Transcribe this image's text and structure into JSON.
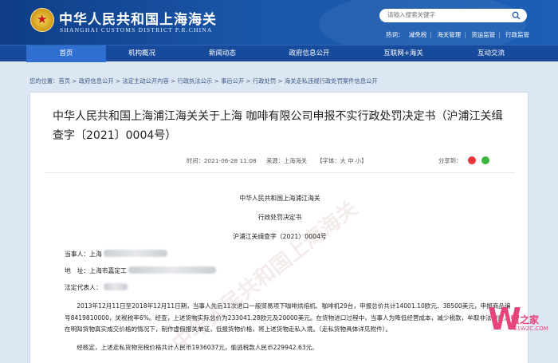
{
  "header": {
    "title": "中华人民共和国上海海关",
    "subtitle": "SHANGHAI CUSTOMS DISTRICT P.R.CHINA",
    "search_placeholder": "请输入搜索关键字",
    "hotwords": [
      "热词：",
      "减免税",
      "海关管理",
      "货运监管",
      "行政监管"
    ]
  },
  "nav": {
    "items": [
      "首页",
      "机构概况",
      "新闻动态",
      "政府信息公开",
      "互联网+海关",
      "互动交流"
    ]
  },
  "breadcrumb": "您的位置：首页 > 政府信息公开 > 法定主动公开内容 > 行政执法公示 > 事后公开 > 行政处罚 > 海关走私违规行政处罚案件信息公开",
  "article": {
    "title": "中华人民共和国上海浦江海关关于上海 咖啡有限公司申报不实行政处罚决定书（沪浦江关缉查字〔2021〕0004号）",
    "date": "时间：2021-06-28 11:08",
    "source": "来源：上海海关",
    "font_size": "【字体：大 中 小】",
    "share_label": "分享到：",
    "doc_org": "中华人民共和国上海浦江海关",
    "doc_type": "行政处罚决定书",
    "doc_no": "沪浦江关缉查字（2021）0004号",
    "party_label": "当事人：上海",
    "address_label": "地　址：上海市嘉定工",
    "rep_label": "法定代表人：",
    "para1": "2013年12月11日至2018年12月11日期，当事人先后11次进口一般贸易项下咖啡烘焙机、咖啡机29台，申报总价共计14001.10欧元、38500美元，申报商品编号8419810000，关税税率6%。经查，上述货物实际总价为233041.28欧元及20000美元。在货物进口过程中，当事人为降低经营成本，减少税款，牟取非法利益，在明知货物真实成交价格的情况下，制作虚假报关单证，低报货物价格，将上述货物走私入境。（走私货物具体详见附件）。",
    "para2": "经核定，上述走私货物完税价格共计人民币1936037元，偷逃税款人民币229942.63元。"
  },
  "logo": {
    "text": "贸之家",
    "url": "51W2C.COM"
  },
  "colors": {
    "header_blue": "#1a56a8",
    "nav_blue": "#174a9a",
    "nav_active": "#2e6fd0",
    "logo_pink": "#e8437a"
  }
}
